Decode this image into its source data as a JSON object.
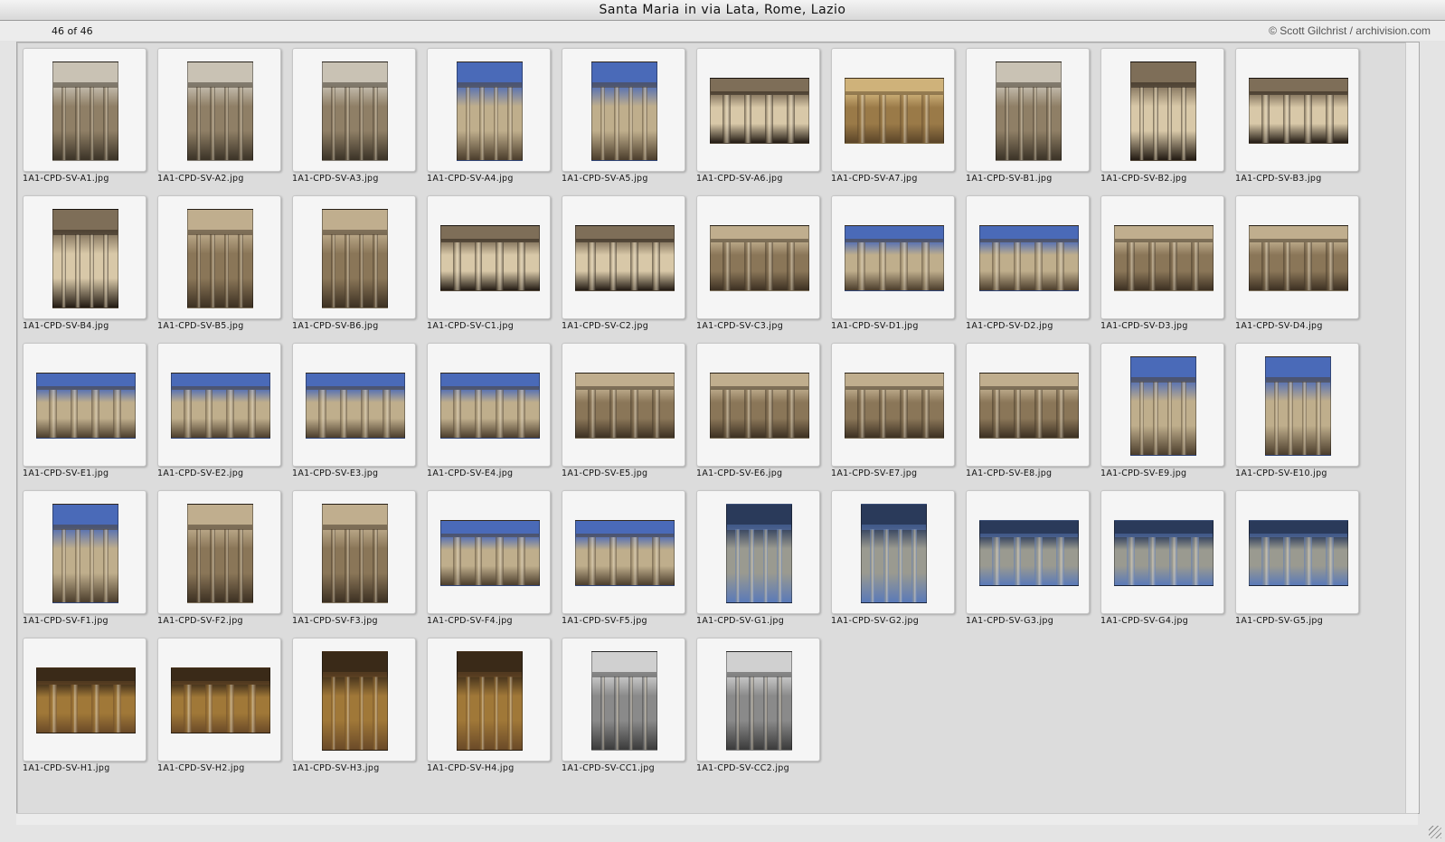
{
  "window": {
    "title": "Santa Maria in via Lata, Rome, Lazio"
  },
  "header": {
    "count": "46 of 46",
    "credit": "© Scott Gilchrist / archivision.com"
  },
  "colors": {
    "sky": "#4a6ab8",
    "stone": "#b8a88a",
    "shadow": "#2e2418",
    "interior": "#7a6040",
    "grey_photo": "#8a8a8a"
  },
  "images": [
    {
      "caption": "1A1-CPD-SV-A1.jpg",
      "orientation": "portrait",
      "palette": "facade"
    },
    {
      "caption": "1A1-CPD-SV-A2.jpg",
      "orientation": "portrait",
      "palette": "facade"
    },
    {
      "caption": "1A1-CPD-SV-A3.jpg",
      "orientation": "portrait",
      "palette": "facade"
    },
    {
      "caption": "1A1-CPD-SV-A4.jpg",
      "orientation": "portrait",
      "palette": "sky"
    },
    {
      "caption": "1A1-CPD-SV-A5.jpg",
      "orientation": "portrait",
      "palette": "sky"
    },
    {
      "caption": "1A1-CPD-SV-A6.jpg",
      "orientation": "landscape",
      "palette": "columns"
    },
    {
      "caption": "1A1-CPD-SV-A7.jpg",
      "orientation": "landscape",
      "palette": "warm"
    },
    {
      "caption": "1A1-CPD-SV-B1.jpg",
      "orientation": "portrait",
      "palette": "facade"
    },
    {
      "caption": "1A1-CPD-SV-B2.jpg",
      "orientation": "portrait",
      "palette": "columns"
    },
    {
      "caption": "1A1-CPD-SV-B3.jpg",
      "orientation": "landscape",
      "palette": "columns"
    },
    {
      "caption": "1A1-CPD-SV-B4.jpg",
      "orientation": "portrait",
      "palette": "columns"
    },
    {
      "caption": "1A1-CPD-SV-B5.jpg",
      "orientation": "portrait",
      "palette": "stone"
    },
    {
      "caption": "1A1-CPD-SV-B6.jpg",
      "orientation": "portrait",
      "palette": "stone"
    },
    {
      "caption": "1A1-CPD-SV-C1.jpg",
      "orientation": "landscape",
      "palette": "columns"
    },
    {
      "caption": "1A1-CPD-SV-C2.jpg",
      "orientation": "landscape",
      "palette": "columns"
    },
    {
      "caption": "1A1-CPD-SV-C3.jpg",
      "orientation": "landscape",
      "palette": "stone"
    },
    {
      "caption": "1A1-CPD-SV-D1.jpg",
      "orientation": "landscape",
      "palette": "sky"
    },
    {
      "caption": "1A1-CPD-SV-D2.jpg",
      "orientation": "landscape",
      "palette": "sky"
    },
    {
      "caption": "1A1-CPD-SV-D3.jpg",
      "orientation": "landscape",
      "palette": "stone"
    },
    {
      "caption": "1A1-CPD-SV-D4.jpg",
      "orientation": "landscape",
      "palette": "stone"
    },
    {
      "caption": "1A1-CPD-SV-E1.jpg",
      "orientation": "landscape",
      "palette": "sky"
    },
    {
      "caption": "1A1-CPD-SV-E2.jpg",
      "orientation": "landscape",
      "palette": "sky"
    },
    {
      "caption": "1A1-CPD-SV-E3.jpg",
      "orientation": "landscape",
      "palette": "sky"
    },
    {
      "caption": "1A1-CPD-SV-E4.jpg",
      "orientation": "landscape",
      "palette": "sky"
    },
    {
      "caption": "1A1-CPD-SV-E5.jpg",
      "orientation": "landscape",
      "palette": "stone"
    },
    {
      "caption": "1A1-CPD-SV-E6.jpg",
      "orientation": "landscape",
      "palette": "stone"
    },
    {
      "caption": "1A1-CPD-SV-E7.jpg",
      "orientation": "landscape",
      "palette": "stone"
    },
    {
      "caption": "1A1-CPD-SV-E8.jpg",
      "orientation": "landscape",
      "palette": "stone"
    },
    {
      "caption": "1A1-CPD-SV-E9.jpg",
      "orientation": "portrait",
      "palette": "sky"
    },
    {
      "caption": "1A1-CPD-SV-E10.jpg",
      "orientation": "portrait",
      "palette": "sky"
    },
    {
      "caption": "1A1-CPD-SV-F1.jpg",
      "orientation": "portrait",
      "palette": "sky"
    },
    {
      "caption": "1A1-CPD-SV-F2.jpg",
      "orientation": "portrait",
      "palette": "stone"
    },
    {
      "caption": "1A1-CPD-SV-F3.jpg",
      "orientation": "portrait",
      "palette": "stone"
    },
    {
      "caption": "1A1-CPD-SV-F4.jpg",
      "orientation": "landscape",
      "palette": "sky"
    },
    {
      "caption": "1A1-CPD-SV-F5.jpg",
      "orientation": "landscape",
      "palette": "sky"
    },
    {
      "caption": "1A1-CPD-SV-G1.jpg",
      "orientation": "portrait",
      "palette": "bluefloor"
    },
    {
      "caption": "1A1-CPD-SV-G2.jpg",
      "orientation": "portrait",
      "palette": "bluefloor"
    },
    {
      "caption": "1A1-CPD-SV-G3.jpg",
      "orientation": "landscape",
      "palette": "bluefloor"
    },
    {
      "caption": "1A1-CPD-SV-G4.jpg",
      "orientation": "landscape",
      "palette": "bluefloor"
    },
    {
      "caption": "1A1-CPD-SV-G5.jpg",
      "orientation": "landscape",
      "palette": "bluefloor"
    },
    {
      "caption": "1A1-CPD-SV-H1.jpg",
      "orientation": "landscape",
      "palette": "interior"
    },
    {
      "caption": "1A1-CPD-SV-H2.jpg",
      "orientation": "landscape",
      "palette": "interior"
    },
    {
      "caption": "1A1-CPD-SV-H3.jpg",
      "orientation": "portrait",
      "palette": "interior"
    },
    {
      "caption": "1A1-CPD-SV-H4.jpg",
      "orientation": "portrait",
      "palette": "interior"
    },
    {
      "caption": "1A1-CPD-SV-CC1.jpg",
      "orientation": "portrait",
      "palette": "grey"
    },
    {
      "caption": "1A1-CPD-SV-CC2.jpg",
      "orientation": "portrait",
      "palette": "grey"
    }
  ]
}
